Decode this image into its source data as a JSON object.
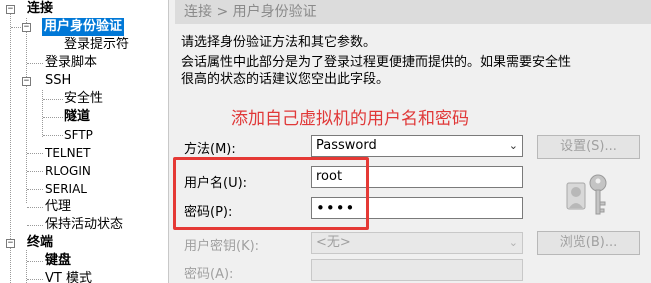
{
  "tree": {
    "items": [
      {
        "label": "连接",
        "level": 0,
        "expander": "−",
        "bold": true,
        "selected": false
      },
      {
        "label": "用户身份验证",
        "level": 1,
        "expander": "−",
        "bold": true,
        "selected": true
      },
      {
        "label": "登录提示符",
        "level": 2,
        "expander": "",
        "bold": false,
        "selected": false
      },
      {
        "label": "登录脚本",
        "level": 1,
        "expander": "",
        "bold": false,
        "selected": false
      },
      {
        "label": "SSH",
        "level": 1,
        "expander": "−",
        "bold": false,
        "selected": false
      },
      {
        "label": "安全性",
        "level": 2,
        "expander": "",
        "bold": false,
        "selected": false
      },
      {
        "label": "隧道",
        "level": 2,
        "expander": "",
        "bold": true,
        "selected": false
      },
      {
        "label": "SFTP",
        "level": 2,
        "expander": "",
        "bold": false,
        "selected": false
      },
      {
        "label": "TELNET",
        "level": 1,
        "expander": "",
        "bold": false,
        "selected": false
      },
      {
        "label": "RLOGIN",
        "level": 1,
        "expander": "",
        "bold": false,
        "selected": false
      },
      {
        "label": "SERIAL",
        "level": 1,
        "expander": "",
        "bold": false,
        "selected": false
      },
      {
        "label": "代理",
        "level": 1,
        "expander": "",
        "bold": false,
        "selected": false
      },
      {
        "label": "保持活动状态",
        "level": 1,
        "expander": "",
        "bold": false,
        "selected": false
      },
      {
        "label": "终端",
        "level": 0,
        "expander": "−",
        "bold": true,
        "selected": false
      },
      {
        "label": "键盘",
        "level": 1,
        "expander": "",
        "bold": true,
        "selected": false
      },
      {
        "label": "VT 模式",
        "level": 1,
        "expander": "",
        "bold": false,
        "selected": false
      }
    ]
  },
  "header": {
    "breadcrumb": "连接 > 用户身份验证"
  },
  "description": {
    "line1": "请选择身份验证方法和其它参数。",
    "line2": "会话属性中此部分是为了登录过程更便捷而提供的。如果需要安全性",
    "line3": "很高的状态的话建议您空出此字段。"
  },
  "annotation": "添加自己虚拟机的用户名和密码",
  "form": {
    "method_label": "方法(M):",
    "method_value": "Password",
    "settings_button": "设置(S)...",
    "username_label": "用户名(U):",
    "username_value": "root",
    "password_label": "密码(P):",
    "password_value": "••••",
    "user_key_label": "用户密钥(K):",
    "user_key_value": "<无>",
    "browse_button": "浏览(B)...",
    "passphrase_label": "密码(A):"
  },
  "colors": {
    "selection": "#0078d7",
    "annotation": "#e03838",
    "highlight_box": "#e53935"
  },
  "icons": {
    "dropdown": "chevron-down-icon",
    "user_key": "user-key-icon"
  }
}
